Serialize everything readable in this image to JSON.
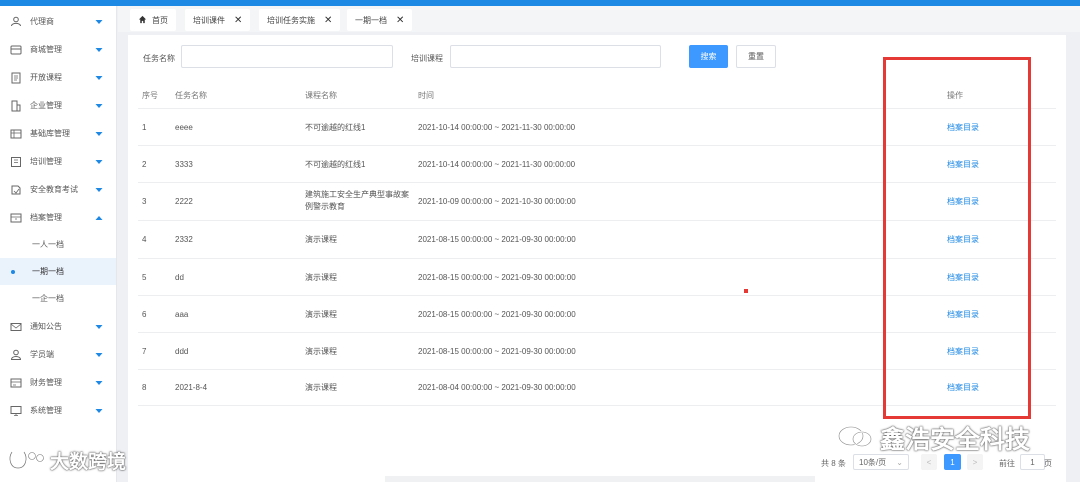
{
  "sidebar": {
    "items": [
      {
        "label": "代理商",
        "icon": "person-icon"
      },
      {
        "label": "商城管理",
        "icon": "store-icon"
      },
      {
        "label": "开放课程",
        "icon": "document-icon"
      },
      {
        "label": "企业管理",
        "icon": "building-icon"
      },
      {
        "label": "基础库管理",
        "icon": "database-icon"
      },
      {
        "label": "培训管理",
        "icon": "training-icon"
      },
      {
        "label": "安全教育考试",
        "icon": "exam-icon"
      },
      {
        "label": "档案管理",
        "icon": "archive-icon",
        "expanded": true
      },
      {
        "label": "通知公告",
        "icon": "mail-icon"
      },
      {
        "label": "学员端",
        "icon": "user-icon"
      },
      {
        "label": "财务管理",
        "icon": "finance-icon"
      },
      {
        "label": "系统管理",
        "icon": "monitor-icon"
      }
    ],
    "archive_sub": [
      "一人一档",
      "一期一档",
      "一企一档"
    ],
    "active_sub": "一期一档"
  },
  "tabs": [
    {
      "label": "首页"
    },
    {
      "label": "培训课件"
    },
    {
      "label": "培训任务实施"
    },
    {
      "label": "一期一档"
    }
  ],
  "filters": {
    "task_label": "任务名称",
    "course_label": "培训课程",
    "task_value": "",
    "course_value": "",
    "search_button": "搜索",
    "reset_button": "重置"
  },
  "table": {
    "headers": [
      "序号",
      "任务名称",
      "课程名称",
      "时间",
      "操作"
    ],
    "rows": [
      {
        "no": "1",
        "task": "eeee",
        "course": "不可逾越的红线1",
        "time": "2021-10-14 00:00:00 ~ 2021-11-30 00:00:00",
        "action": "档案目录"
      },
      {
        "no": "2",
        "task": "3333",
        "course": "不可逾越的红线1",
        "time": "2021-10-14 00:00:00 ~ 2021-11-30 00:00:00",
        "action": "档案目录"
      },
      {
        "no": "3",
        "task": "2222",
        "course": "建筑施工安全生产典型事故案例警示教育",
        "time": "2021-10-09 00:00:00 ~ 2021-10-30 00:00:00",
        "action": "档案目录"
      },
      {
        "no": "4",
        "task": "2332",
        "course": "演示课程",
        "time": "2021-08-15 00:00:00 ~ 2021-09-30 00:00:00",
        "action": "档案目录"
      },
      {
        "no": "5",
        "task": "dd",
        "course": "演示课程",
        "time": "2021-08-15 00:00:00 ~ 2021-09-30 00:00:00",
        "action": "档案目录"
      },
      {
        "no": "6",
        "task": "aaa",
        "course": "演示课程",
        "time": "2021-08-15 00:00:00 ~ 2021-09-30 00:00:00",
        "action": "档案目录"
      },
      {
        "no": "7",
        "task": "ddd",
        "course": "演示课程",
        "time": "2021-08-15 00:00:00 ~ 2021-09-30 00:00:00",
        "action": "档案目录"
      },
      {
        "no": "8",
        "task": "2021-8-4",
        "course": "演示课程",
        "time": "2021-08-04 00:00:00 ~ 2021-09-30 00:00:00",
        "action": "档案目录"
      }
    ]
  },
  "pagination": {
    "total": "共 8 条",
    "page_size": "10条/页",
    "prev": "<",
    "current": "1",
    "next": ">",
    "goto_label": "前往",
    "goto_value": "1",
    "page_unit": "页"
  },
  "watermarks": {
    "right": "鑫浩安全科技",
    "left": "大数跨境"
  },
  "colors": {
    "accent": "#1e88e5",
    "primary_button": "#3d98ff",
    "highlight_box": "#e53935"
  }
}
